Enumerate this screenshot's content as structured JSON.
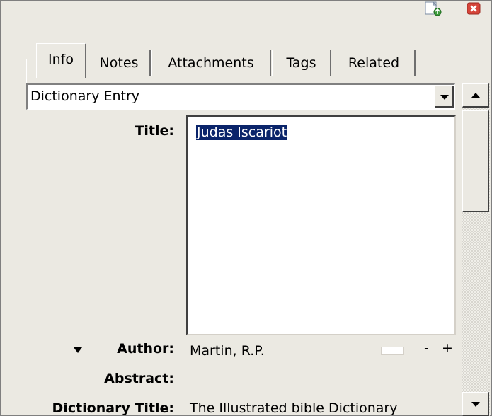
{
  "tabs": [
    "Info",
    "Notes",
    "Attachments",
    "Tags",
    "Related"
  ],
  "item_type": {
    "selected": "Dictionary Entry"
  },
  "fields": {
    "title_label": "Title:",
    "title_value": "Judas Iscariot",
    "author_label": "Author:",
    "author_value": "Martin,   R.P.",
    "author_minus": "-",
    "author_plus": "+",
    "abstract_label": "Abstract:",
    "dictionary_title_label": "Dictionary Title:",
    "dictionary_title_value": "The Illustrated bible Dictionary"
  },
  "icons": [
    "new-document-icon",
    "close-icon",
    "expand-triangle-icon",
    "dropdown-arrow-icon",
    "scroll-up-icon",
    "scroll-down-icon"
  ]
}
